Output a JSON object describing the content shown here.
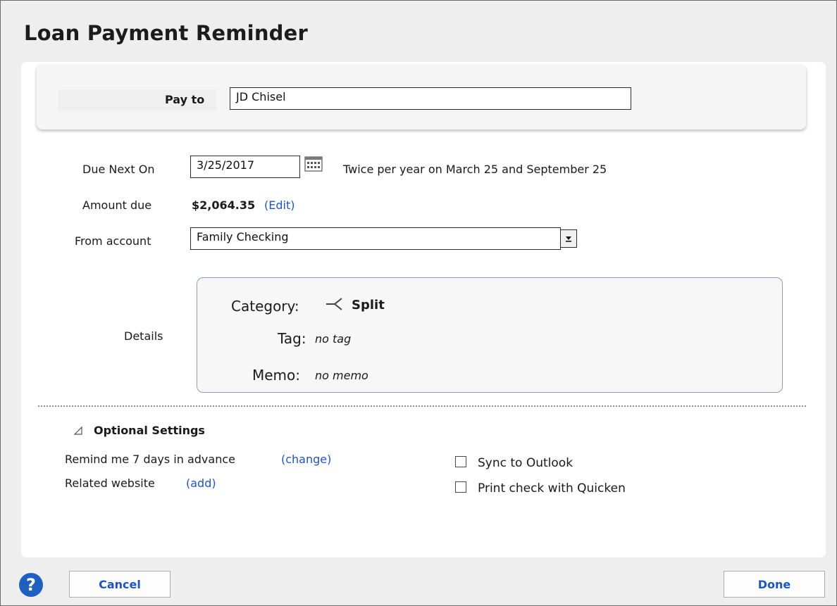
{
  "dialog": {
    "title": "Loan Payment Reminder"
  },
  "pay_to": {
    "label": "Pay to",
    "value": "JD Chisel"
  },
  "due_next": {
    "label": "Due Next On",
    "value": "3/25/2017",
    "frequency": "Twice per year on March 25 and September 25"
  },
  "amount": {
    "label": "Amount due",
    "value": "$2,064.35",
    "edit_link": "(Edit)"
  },
  "from_account": {
    "label": "From account",
    "value": "Family Checking"
  },
  "details": {
    "label": "Details",
    "category_label": "Category:",
    "category_value": "Split",
    "tag_label": "Tag:",
    "tag_value": "no tag",
    "memo_label": "Memo:",
    "memo_value": "no memo"
  },
  "optional": {
    "header": "Optional Settings",
    "remind_text": "Remind me 7 days in advance",
    "remind_link": "(change)",
    "website_text": "Related website",
    "website_link": "(add)",
    "sync_label": "Sync to Outlook",
    "print_label": "Print check with Quicken"
  },
  "footer": {
    "help_glyph": "?",
    "cancel_label": "Cancel",
    "done_label": "Done"
  },
  "colors": {
    "link": "#1f54c4",
    "help_icon": "#1f5fc0",
    "details_border": "#8aa0be"
  }
}
